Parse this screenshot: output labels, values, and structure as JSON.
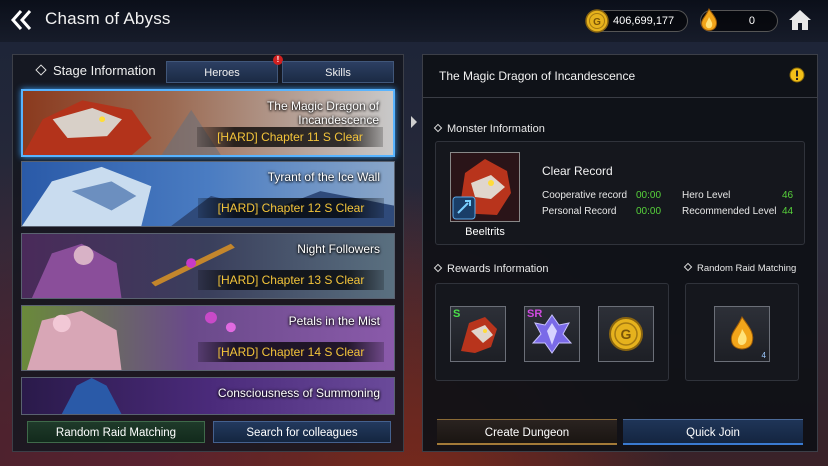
{
  "header": {
    "title": "Chasm of Abyss",
    "gold": "406,699,177",
    "flame": "0"
  },
  "left_panel": {
    "title": "Stage Information",
    "tabs": {
      "heroes": "Heroes",
      "skills": "Skills",
      "heroes_badge": "!"
    },
    "stages": [
      {
        "name": "The Magic Dragon of Incandescence",
        "status": "[HARD] Chapter 11 S Clear",
        "selected": true
      },
      {
        "name": "Tyrant of the Ice Wall",
        "status": "[HARD] Chapter 12 S Clear",
        "selected": false
      },
      {
        "name": "Night Followers",
        "status": "[HARD] Chapter 13 S Clear",
        "selected": false
      },
      {
        "name": "Petals in the Mist",
        "status": "[HARD] Chapter 14 S Clear",
        "selected": false
      },
      {
        "name": "Consciousness of Summoning",
        "status": "",
        "selected": false
      }
    ],
    "buttons": {
      "raid": "Random Raid Matching",
      "search": "Search for colleagues"
    }
  },
  "right_panel": {
    "title": "The Magic Dragon of Incandescence",
    "monster_section": "Monster Information",
    "monster_name": "Beeltrits",
    "clear_record": "Clear Record",
    "records": {
      "coop_label": "Cooperative record",
      "coop_value": "00:00",
      "personal_label": "Personal Record",
      "personal_value": "00:00",
      "hero_level_label": "Hero Level",
      "hero_level_value": "46",
      "rec_level_label": "Recommended Level",
      "rec_level_value": "44"
    },
    "rewards_section": "Rewards Information",
    "raid_section": "Random Raid Matching",
    "rewards": [
      {
        "grade": "S",
        "icon": "dragon-head-icon"
      },
      {
        "grade": "SR",
        "icon": "crystal-icon"
      },
      {
        "grade": "",
        "icon": "gold-coin-icon"
      }
    ],
    "raid_reward": {
      "icon": "flame-icon",
      "qty": "4"
    },
    "buttons": {
      "create": "Create Dungeon",
      "quick": "Quick Join"
    }
  },
  "colors": {
    "accent_blue": "#58b4ff",
    "clear_gold": "#f3c43a",
    "record_green": "#57d23b"
  }
}
